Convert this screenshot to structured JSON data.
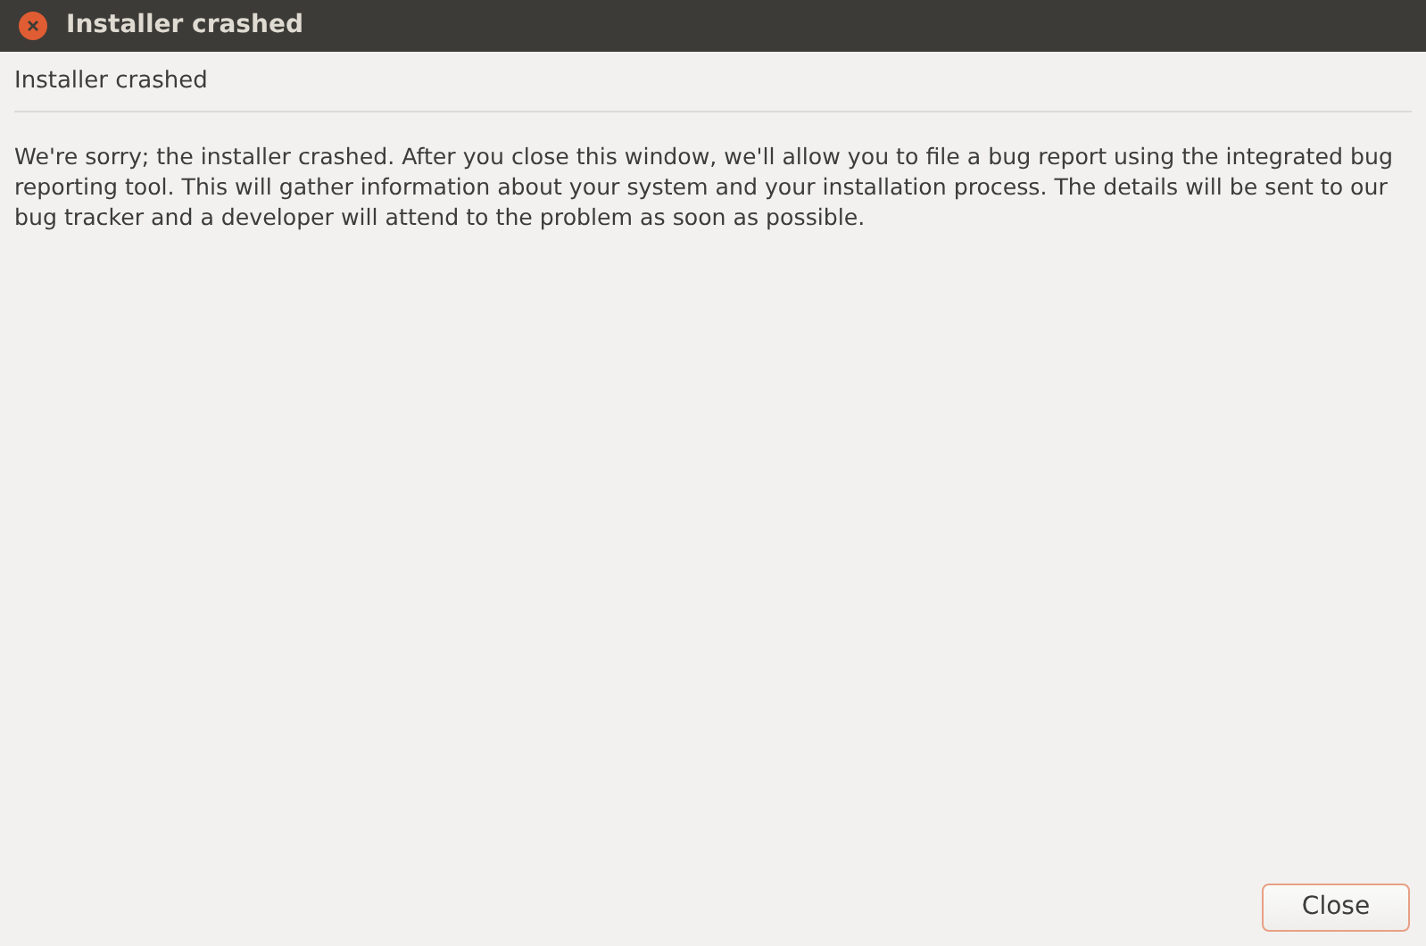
{
  "window": {
    "title": "Installer crashed"
  },
  "heading": "Installer crashed",
  "message": "We're sorry; the installer crashed. After you close this window, we'll allow you to file a bug report using the integrated bug reporting tool. This will gather information about your system and your installation process. The details will be sent to our bug tracker and a developer will attend to the problem as soon as possible.",
  "buttons": [
    {
      "label": "Close"
    }
  ]
}
